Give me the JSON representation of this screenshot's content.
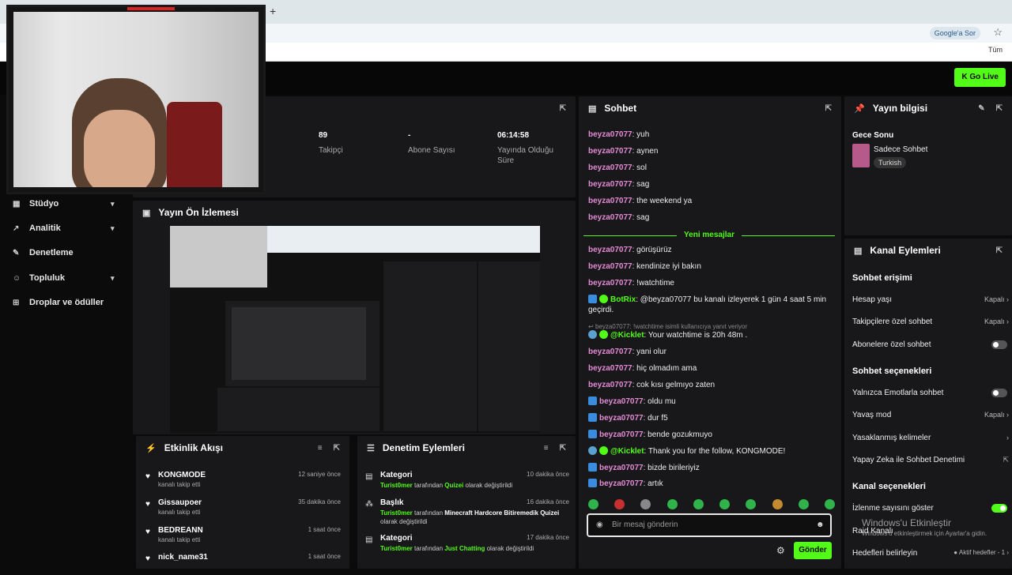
{
  "browser": {
    "new_tab": "+",
    "google_chip": "Google'a Sor",
    "bookmarks_folder": "Tüm"
  },
  "topbar": {
    "go_live": "Go Live"
  },
  "sidebar": {
    "items": [
      {
        "label": "Stüdyo",
        "icon": "studio-icon",
        "chevron": true
      },
      {
        "label": "Analitik",
        "icon": "analytics-icon",
        "chevron": true
      },
      {
        "label": "Denetleme",
        "icon": "wrench-icon",
        "chevron": false
      },
      {
        "label": "Topluluk",
        "icon": "community-icon",
        "chevron": true
      },
      {
        "label": "Droplar ve ödüller",
        "icon": "gift-icon",
        "chevron": false
      }
    ]
  },
  "stats": {
    "followers": {
      "value": "89",
      "label": "Takipçi"
    },
    "subs": {
      "value": "-",
      "label": "Abone Sayısı"
    },
    "uptime": {
      "value": "06:14:58",
      "label": "Yayında Olduğu Süre"
    }
  },
  "preview": {
    "title": "Yayın Ön İzlemesi"
  },
  "activity": {
    "title": "Etkinlik Akışı",
    "items": [
      {
        "name": "KONGMODE",
        "sub": "kanalı takip etti",
        "time": "12 saniye önce"
      },
      {
        "name": "Gissaupoer",
        "sub": "kanalı takip etti",
        "time": "35 dakika önce"
      },
      {
        "name": "BEDREANN",
        "sub": "kanalı takip etti",
        "time": "1 saat önce"
      },
      {
        "name": "nick_name31",
        "sub": "",
        "time": "1 saat önce"
      }
    ]
  },
  "moderation": {
    "title": "Denetim Eylemleri",
    "items": [
      {
        "type": "Kategori",
        "time": "10 dakika önce",
        "user": "Turist0mer",
        "mid": "tarafından",
        "value": "Quizei",
        "end": "olarak değiştirildi"
      },
      {
        "type": "Başlık",
        "time": "16 dakika önce",
        "user": "Turist0mer",
        "mid": "tarafından",
        "value": "Minecraft Hardcore Bitiremedik Quizei",
        "end": "olarak değiştirildi"
      },
      {
        "type": "Kategori",
        "time": "17 dakika önce",
        "user": "Turist0mer",
        "mid": "tarafından",
        "value": "Just Chatting",
        "end": "olarak değiştirildi"
      }
    ]
  },
  "chat": {
    "title": "Sohbet",
    "new_messages": "Yeni mesajlar",
    "reply_hint": "beyza07077: !watchtime isimli kullanıcıya yanıt veriyor",
    "placeholder": "Bir mesaj gönderin",
    "send": "Gönder",
    "messages": [
      {
        "user": "beyza07077",
        "text": ": yuh",
        "kind": "user"
      },
      {
        "user": "beyza07077",
        "text": ": aynen",
        "kind": "user"
      },
      {
        "user": "beyza07077",
        "text": ": sol",
        "kind": "user"
      },
      {
        "user": "beyza07077",
        "text": ": sag",
        "kind": "user"
      },
      {
        "user": "beyza07077",
        "text": ": the weekend ya",
        "kind": "user"
      },
      {
        "user": "beyza07077",
        "text": ": sag",
        "kind": "user"
      },
      {
        "user": "beyza07077",
        "text": ": görüşürüz",
        "kind": "user"
      },
      {
        "user": "beyza07077",
        "text": ": kendinize iyi bakın",
        "kind": "user"
      },
      {
        "user": "beyza07077",
        "text": ": !watchtime",
        "kind": "user"
      },
      {
        "user": "BotRix",
        "text": ": @beyza07077 bu kanalı izleyerek 1 gün 4 saat 5 min geçirdi.",
        "kind": "botrix"
      },
      {
        "user": "@Kicklet",
        "text": ": Your watchtime is 20h 48m .",
        "kind": "kicklet"
      },
      {
        "user": "beyza07077",
        "text": ": yani olur",
        "kind": "user"
      },
      {
        "user": "beyza07077",
        "text": ": hiç olmadım ama",
        "kind": "user"
      },
      {
        "user": "beyza07077",
        "text": ": cok kısı gelmıyo zaten",
        "kind": "user"
      },
      {
        "user": "beyza07077",
        "text": ": oldu mu",
        "kind": "badge"
      },
      {
        "user": "beyza07077",
        "text": ": dur f5",
        "kind": "badge"
      },
      {
        "user": "beyza07077",
        "text": ": bende gozukmuyo",
        "kind": "badge"
      },
      {
        "user": "@Kicklet",
        "text": ": Thank you for the follow, KONGMODE!",
        "kind": "kicklet"
      },
      {
        "user": "beyza07077",
        "text": ": bizde birileriyiz",
        "kind": "badge"
      },
      {
        "user": "beyza07077",
        "text": ": artık",
        "kind": "badge"
      }
    ]
  },
  "info": {
    "title": "Yayın bilgisi",
    "stream_title": "Gece Sonu",
    "category": "Sadece Sohbet",
    "language": "Turkish"
  },
  "channel": {
    "title": "Kanal Eylemleri",
    "sec1": "Sohbet erişimi",
    "age": {
      "label": "Hesap yaşı",
      "value": "Kapalı"
    },
    "followers_only": {
      "label": "Takipçilere özel sohbet",
      "value": "Kapalı"
    },
    "subs_only": {
      "label": "Abonelere özel sohbet"
    },
    "sec2": "Sohbet seçenekleri",
    "emote_only": {
      "label": "Yalnızca Emotlarla sohbet"
    },
    "slow": {
      "label": "Yavaş mod",
      "value": "Kapalı"
    },
    "banned": {
      "label": "Yasaklanmış kelimeler"
    },
    "ai": {
      "label": "Yapay Zeka ile Sohbet Denetimi"
    },
    "sec3": "Kanal seçenekleri",
    "viewers": {
      "label": "İzlenme sayısını göster"
    },
    "raid": {
      "label": "Raid Kanalı"
    },
    "goals": {
      "label": "Hedefleri belirleyin",
      "value": "Aktif hedefler - 1"
    }
  },
  "watermark": {
    "title": "Windows'u Etkinleştir",
    "sub": "Windows'u etkinleştirmek için Ayarlar'a gidin."
  },
  "colors": {
    "accent": "#53fc18",
    "username": "#e58bd6",
    "panel": "#18181b",
    "bg": "#0b0b0c"
  }
}
